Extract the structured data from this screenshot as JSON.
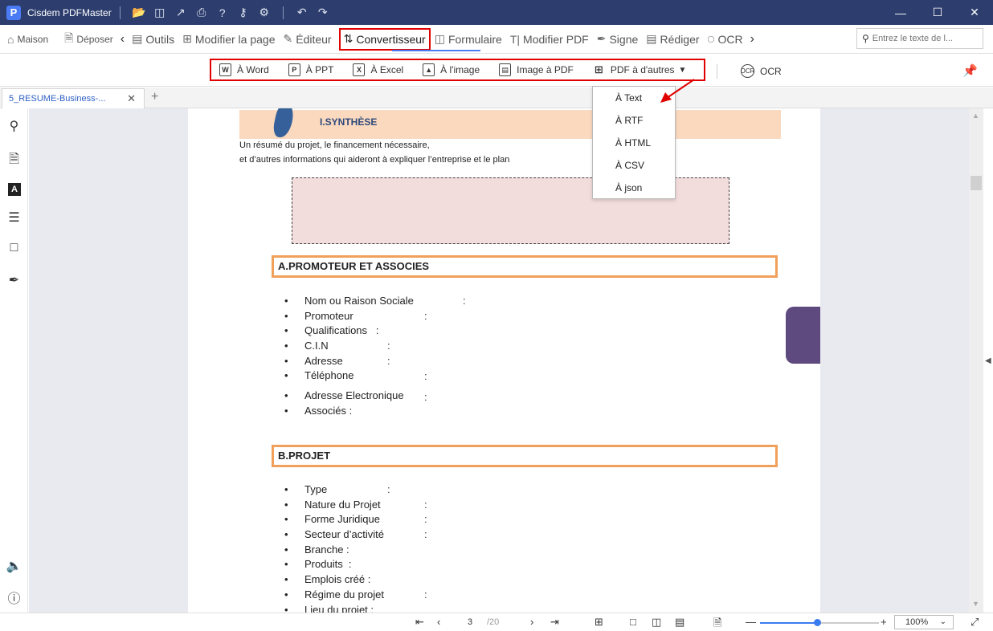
{
  "app": {
    "logo_letter": "P",
    "title": "Cisdem PDFMaster"
  },
  "titlebar_icons": [
    "folder-open-icon",
    "save-icon",
    "share-icon",
    "print-icon",
    "help-icon",
    "key-icon",
    "settings-icon",
    "undo-icon",
    "redo-icon"
  ],
  "window": {
    "minimize": "—",
    "maximize": "☐",
    "close": "✕"
  },
  "toolbar": {
    "home": "Maison",
    "drop": "Déposer",
    "tools": "Outils",
    "modify_page": "Modifier la page",
    "editor": "Éditeur",
    "converter": "Convertisseur",
    "form": "Formulaire",
    "modify_pdf": "Modifier PDF",
    "sign": "Signe",
    "redact": "Rédiger",
    "ocr": "OCR",
    "search_placeholder": "Entrez le texte de l..."
  },
  "subtoolbar": {
    "to_word": "À Word",
    "to_ppt": "À PPT",
    "to_excel": "À Excel",
    "to_image": "À l'image",
    "image_to_pdf": "Image à PDF",
    "pdf_to_others": "PDF à d'autres",
    "ocr": "OCR"
  },
  "dropdown": {
    "items": [
      "À Text",
      "À RTF",
      "À HTML",
      "À CSV",
      "À json"
    ]
  },
  "tabs": [
    {
      "label": "5_RESUME-Business-..."
    }
  ],
  "document": {
    "synthesis_title": "I.SYNTHÈSE",
    "intro_line1": "Un résumé du projet, le financement nécessaire,",
    "intro_line2": "et d’autres informations qui aideront à expliquer l’entreprise et le plan",
    "section_a": "A.PROMOTEUR ET ASSOCIES",
    "section_a_items": [
      "Nom ou Raison Sociale",
      "Promoteur",
      "Qualifications   :",
      "C.I.N",
      "Adresse",
      "Téléphone",
      "Adresse Electronique",
      "Associés :"
    ],
    "section_b": "B.PROJET",
    "section_b_items": [
      "Type",
      "Nature du Projet",
      "Forme Juridique",
      "Secteur d’activité",
      "Branche :",
      "Produits  :",
      "Emplois créé :",
      "Régime du projet",
      "Lieu du projet :"
    ],
    "colon": ":"
  },
  "status": {
    "current_page": "3",
    "total_pages": "/20",
    "zoom": "100%",
    "zoom_level": 0.48
  },
  "colors": {
    "titlebar": "#2d3e6e",
    "highlight_red": "#e00000",
    "section_orange": "#f0a05a",
    "accent_blue": "#3b7bf0"
  }
}
